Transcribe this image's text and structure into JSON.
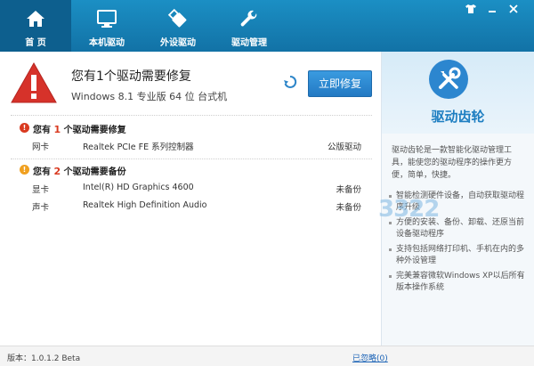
{
  "nav": {
    "items": [
      {
        "label": "首 页",
        "icon": "home-icon"
      },
      {
        "label": "本机驱动",
        "icon": "monitor-icon"
      },
      {
        "label": "外设驱动",
        "icon": "usb-icon"
      },
      {
        "label": "驱动管理",
        "icon": "wrench-icon"
      }
    ],
    "active_index": 0
  },
  "window_controls": {
    "shirt": "skin-icon",
    "minimize": "minimize-icon",
    "close": "close-icon"
  },
  "status": {
    "title": "您有1个驱动需要修复",
    "system": "Windows 8.1 专业版 64 位 台式机",
    "fix_button": "立即修复"
  },
  "repair_section": {
    "prefix": "您有",
    "count": "1",
    "suffix": "个驱动需要修复",
    "rows": [
      {
        "type": "网卡",
        "device": "Realtek PCIe FE 系列控制器",
        "status": "公版驱动"
      }
    ]
  },
  "backup_section": {
    "prefix": "您有",
    "count": "2",
    "suffix": "个驱动需要备份",
    "rows": [
      {
        "type": "显卡",
        "device": "Intel(R) HD Graphics 4600",
        "status": "未备份"
      },
      {
        "type": "声卡",
        "device": "Realtek High Definition Audio",
        "status": "未备份"
      }
    ]
  },
  "sidebar": {
    "product_name": "驱动齿轮",
    "description": "驱动齿轮是一款智能化驱动管理工具，能使您的驱动程序的操作更方便，简单，快捷。",
    "features": [
      "智能检测硬件设备，自动获取驱动程序升级",
      "方便的安装、备份、卸载、还原当前设备驱动程序",
      "支持包括网络打印机、手机在内的多种外设管理",
      "完美兼容微软Windows XP以后所有版本操作系统"
    ],
    "watermark": "3322"
  },
  "footer": {
    "version": "版本：1.0.1.2 Beta",
    "ignored_link": "已忽略(0)"
  },
  "colors": {
    "accent": "#1b8fc4",
    "warning_red": "#d93a20",
    "backup_orange": "#f0a020"
  }
}
